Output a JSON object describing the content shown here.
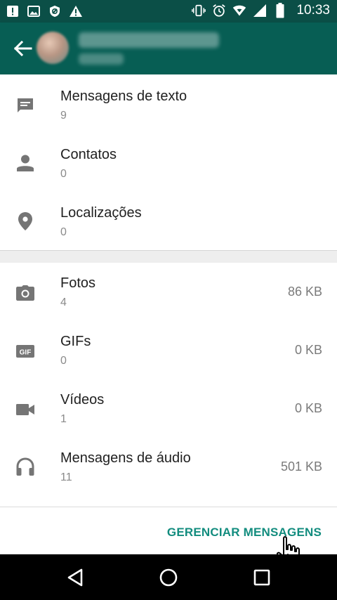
{
  "status_bar": {
    "time": "10:33",
    "left_icons": [
      "alert-box-icon",
      "image-icon",
      "shield-icon",
      "warning-icon"
    ],
    "right_icons": [
      "vibrate-icon",
      "alarm-icon",
      "wifi-icon",
      "signal-icon",
      "battery-icon"
    ]
  },
  "app_bar": {
    "back_icon": "arrow-back-icon"
  },
  "sections": {
    "messages": [
      {
        "title": "Mensagens de texto",
        "count": "9",
        "icon": "message-icon"
      },
      {
        "title": "Contatos",
        "count": "0",
        "icon": "person-icon"
      },
      {
        "title": "Localizações",
        "count": "0",
        "icon": "location-pin-icon"
      }
    ],
    "media": [
      {
        "title": "Fotos",
        "count": "4",
        "size": "86 KB",
        "icon": "camera-icon"
      },
      {
        "title": "GIFs",
        "count": "0",
        "size": "0 KB",
        "icon": "gif-icon"
      },
      {
        "title": "Vídeos",
        "count": "1",
        "size": "0 KB",
        "icon": "video-icon"
      },
      {
        "title": "Mensagens de áudio",
        "count": "11",
        "size": "501 KB",
        "icon": "headphones-icon"
      }
    ]
  },
  "manage_button": {
    "label": "GERENCIAR MENSAGENS"
  },
  "colors": {
    "status_bar": "#0b4f47",
    "app_bar": "#075e54",
    "accent": "#128c7e"
  },
  "nav_bar": {
    "icons": [
      "back-triangle-icon",
      "home-circle-icon",
      "recents-square-icon"
    ]
  }
}
